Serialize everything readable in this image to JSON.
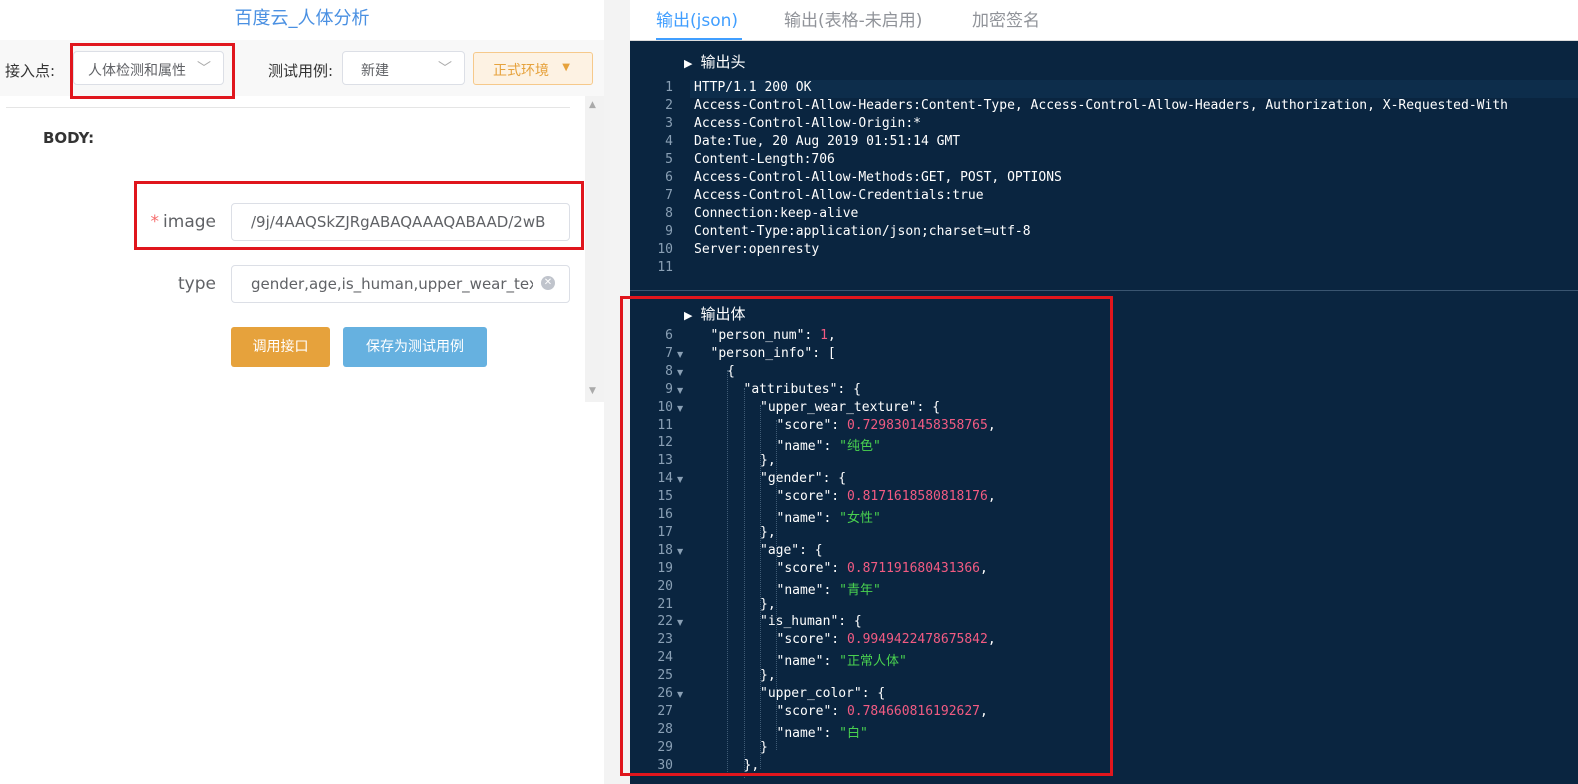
{
  "left": {
    "title": "百度云_人体分析",
    "entry_label": "接入点:",
    "entry_value": "人体检测和属性",
    "testcase_label": "测试用例:",
    "testcase_value": "新建",
    "env_label": "正式环境",
    "body_label": "BODY:",
    "image_label": "image",
    "image_required": "*",
    "image_value": "/9j/4AAQSkZJRgABAQAAAQABAAD/2wB",
    "type_label": "type",
    "type_value": "gender,age,is_human,upper_wear_texture",
    "call_button": "调用接口",
    "save_button": "保存为测试用例"
  },
  "tabs": [
    "输出(json)",
    "输出(表格-未启用)",
    "加密签名"
  ],
  "active_tab": 0,
  "header_section": {
    "title": "输出头",
    "lines": [
      {
        "n": "1",
        "t": "HTTP/1.1 200 OK"
      },
      {
        "n": "2",
        "t": "Access-Control-Allow-Headers:Content-Type, Access-Control-Allow-Headers, Authorization, X-Requested-With"
      },
      {
        "n": "3",
        "t": "Access-Control-Allow-Origin:*"
      },
      {
        "n": "4",
        "t": "Date:Tue, 20 Aug 2019 01:51:14 GMT"
      },
      {
        "n": "5",
        "t": "Content-Length:706"
      },
      {
        "n": "6",
        "t": "Access-Control-Allow-Methods:GET, POST, OPTIONS"
      },
      {
        "n": "7",
        "t": "Access-Control-Allow-Credentials:true"
      },
      {
        "n": "8",
        "t": "Connection:keep-alive"
      },
      {
        "n": "9",
        "t": "Content-Type:application/json;charset=utf-8"
      },
      {
        "n": "10",
        "t": "Server:openresty"
      },
      {
        "n": "11",
        "t": ""
      }
    ]
  },
  "body_section": {
    "title": "输出体",
    "lines": [
      {
        "n": "6",
        "fold": false,
        "indent": 2,
        "key": "\"person_num\"",
        "sep": ": ",
        "num": "1",
        "tail": ","
      },
      {
        "n": "7",
        "fold": true,
        "indent": 2,
        "key": "\"person_info\"",
        "sep": ": [",
        "tail": ""
      },
      {
        "n": "8",
        "fold": true,
        "indent": 3,
        "plain": "{"
      },
      {
        "n": "9",
        "fold": true,
        "indent": 4,
        "key": "\"attributes\"",
        "sep": ": {",
        "tail": ""
      },
      {
        "n": "10",
        "fold": true,
        "indent": 5,
        "key": "\"upper_wear_texture\"",
        "sep": ": {",
        "tail": ""
      },
      {
        "n": "11",
        "fold": false,
        "indent": 6,
        "key": "\"score\"",
        "sep": ": ",
        "num": "0.7298301458358765",
        "tail": ","
      },
      {
        "n": "12",
        "fold": false,
        "indent": 6,
        "key": "\"name\"",
        "sep": ": ",
        "str": "\"纯色\"",
        "tail": ""
      },
      {
        "n": "13",
        "fold": false,
        "indent": 5,
        "plain": "},"
      },
      {
        "n": "14",
        "fold": true,
        "indent": 5,
        "key": "\"gender\"",
        "sep": ": {",
        "tail": ""
      },
      {
        "n": "15",
        "fold": false,
        "indent": 6,
        "key": "\"score\"",
        "sep": ": ",
        "num": "0.8171618580818176",
        "tail": ","
      },
      {
        "n": "16",
        "fold": false,
        "indent": 6,
        "key": "\"name\"",
        "sep": ": ",
        "str": "\"女性\"",
        "tail": ""
      },
      {
        "n": "17",
        "fold": false,
        "indent": 5,
        "plain": "},"
      },
      {
        "n": "18",
        "fold": true,
        "indent": 5,
        "key": "\"age\"",
        "sep": ": {",
        "tail": ""
      },
      {
        "n": "19",
        "fold": false,
        "indent": 6,
        "key": "\"score\"",
        "sep": ": ",
        "num": "0.871191680431366",
        "tail": ","
      },
      {
        "n": "20",
        "fold": false,
        "indent": 6,
        "key": "\"name\"",
        "sep": ": ",
        "str": "\"青年\"",
        "tail": ""
      },
      {
        "n": "21",
        "fold": false,
        "indent": 5,
        "plain": "},"
      },
      {
        "n": "22",
        "fold": true,
        "indent": 5,
        "key": "\"is_human\"",
        "sep": ": {",
        "tail": ""
      },
      {
        "n": "23",
        "fold": false,
        "indent": 6,
        "key": "\"score\"",
        "sep": ": ",
        "num": "0.9949422478675842",
        "tail": ","
      },
      {
        "n": "24",
        "fold": false,
        "indent": 6,
        "key": "\"name\"",
        "sep": ": ",
        "str": "\"正常人体\"",
        "tail": ""
      },
      {
        "n": "25",
        "fold": false,
        "indent": 5,
        "plain": "},"
      },
      {
        "n": "26",
        "fold": true,
        "indent": 5,
        "key": "\"upper_color\"",
        "sep": ": {",
        "tail": ""
      },
      {
        "n": "27",
        "fold": false,
        "indent": 6,
        "key": "\"score\"",
        "sep": ": ",
        "num": "0.784660816192627",
        "tail": ","
      },
      {
        "n": "28",
        "fold": false,
        "indent": 6,
        "key": "\"name\"",
        "sep": ": ",
        "str": "\"白\"",
        "tail": ""
      },
      {
        "n": "29",
        "fold": false,
        "indent": 5,
        "plain": "}"
      },
      {
        "n": "30",
        "fold": false,
        "indent": 4,
        "plain": "},"
      }
    ]
  },
  "colors": {
    "accent": "#409eff",
    "highlight_box": "#e0161d",
    "code_bg": "#0a2540",
    "number": "#f25b82",
    "string": "#49d14f"
  }
}
